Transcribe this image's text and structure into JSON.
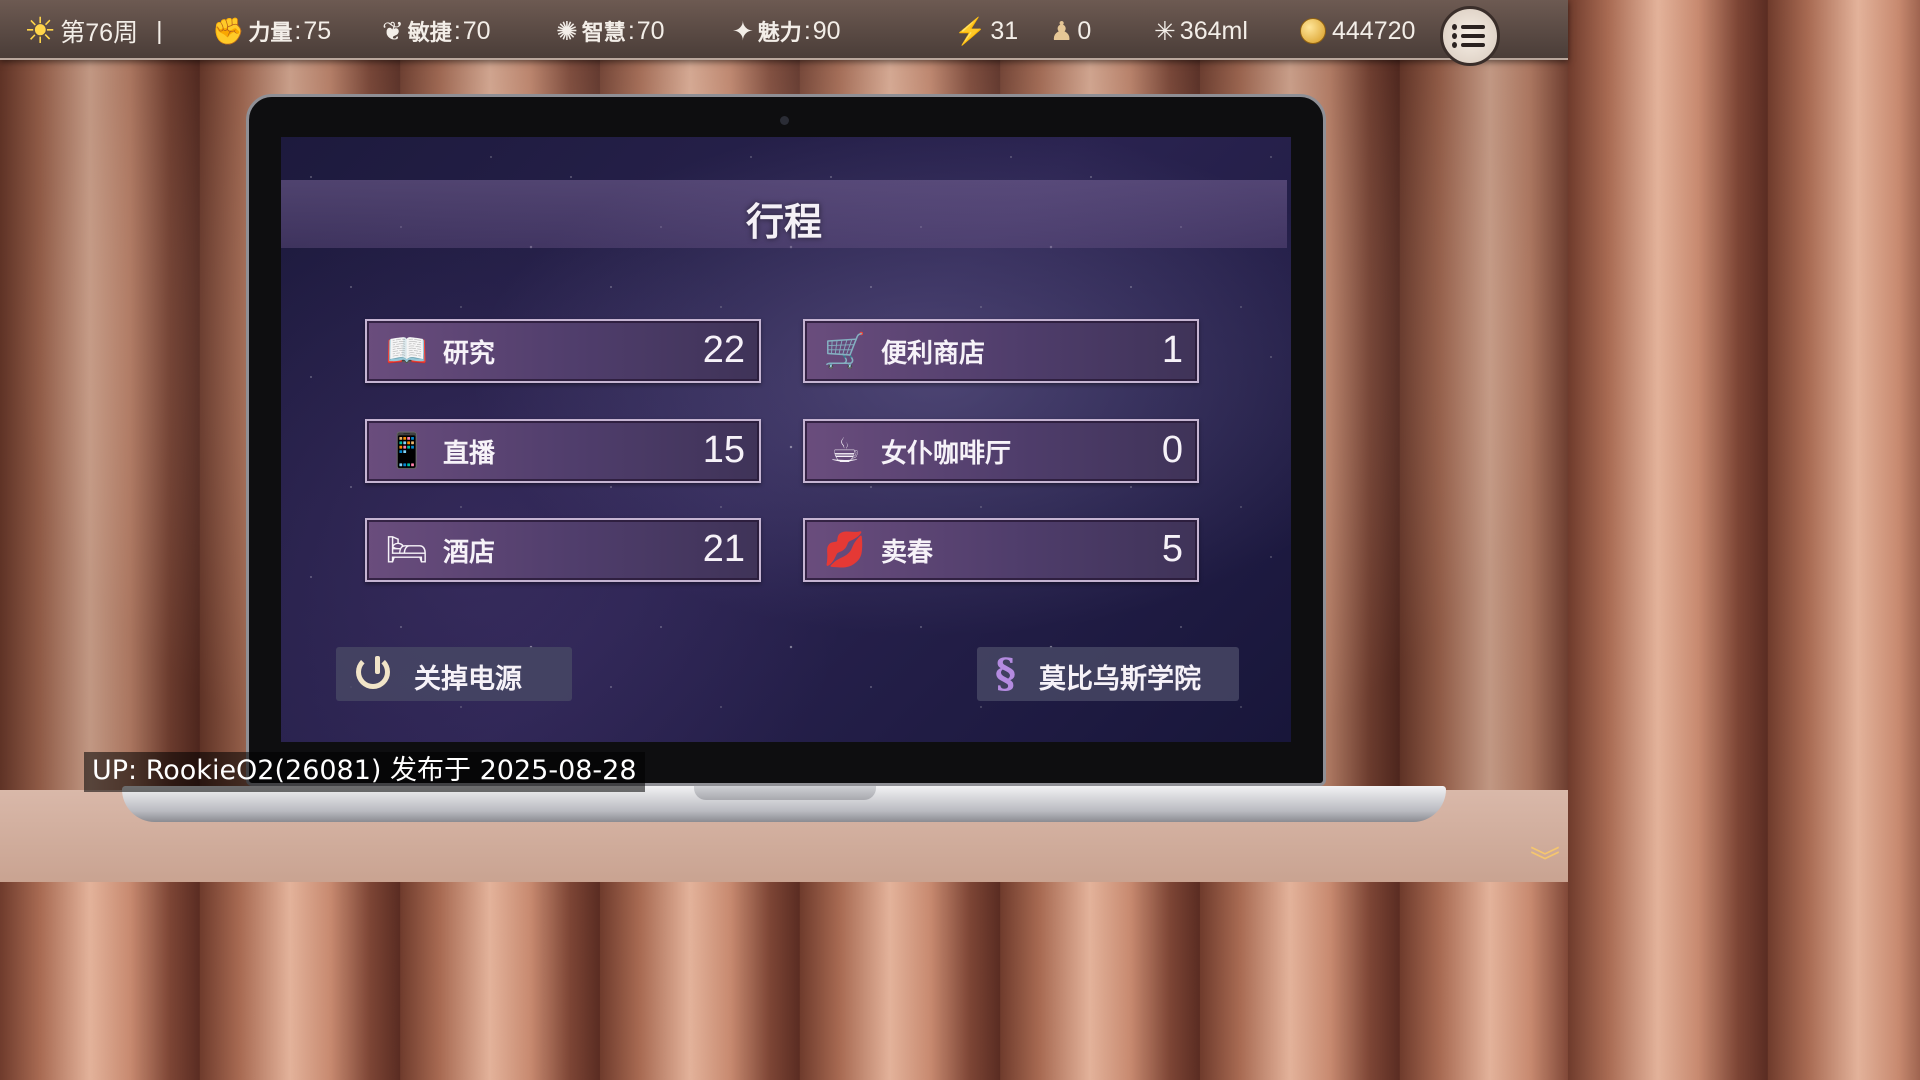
{
  "topbar": {
    "week": "第76周",
    "divider": "|",
    "stats": [
      {
        "icon": "strength-fist-icon",
        "label": "力量",
        "value": "75"
      },
      {
        "icon": "agility-wing-icon",
        "label": "敏捷",
        "value": "70"
      },
      {
        "icon": "wisdom-bulb-icon",
        "label": "智慧",
        "value": "70"
      },
      {
        "icon": "charm-sparkle-icon",
        "label": "魅力",
        "value": "90"
      }
    ],
    "energy": "31",
    "stress": "0",
    "fluid": "364ml",
    "money": "444720",
    "colon": ":"
  },
  "screen": {
    "title": "行程",
    "tiles": [
      {
        "label": "研究",
        "count": "22",
        "icon": "research-book-icon"
      },
      {
        "label": "便利商店",
        "count": "1",
        "icon": "shopping-cart-icon"
      },
      {
        "label": "直播",
        "count": "15",
        "icon": "smartphone-icon"
      },
      {
        "label": "女仆咖啡厅",
        "count": "0",
        "icon": "coffee-cup-icon"
      },
      {
        "label": "酒店",
        "count": "21",
        "icon": "bed-icon"
      },
      {
        "label": "卖春",
        "count": "5",
        "icon": "lips-icon"
      }
    ],
    "power_button": "关掉电源",
    "academy_button": "莫比乌斯学院"
  },
  "credit": "UP: RookieO2(26081) 发布于 2025-08-28",
  "colors": {
    "tile_border": "#c5b4d2",
    "tile_bg": "#5a4374",
    "accent_gold": "#ffd54a"
  }
}
